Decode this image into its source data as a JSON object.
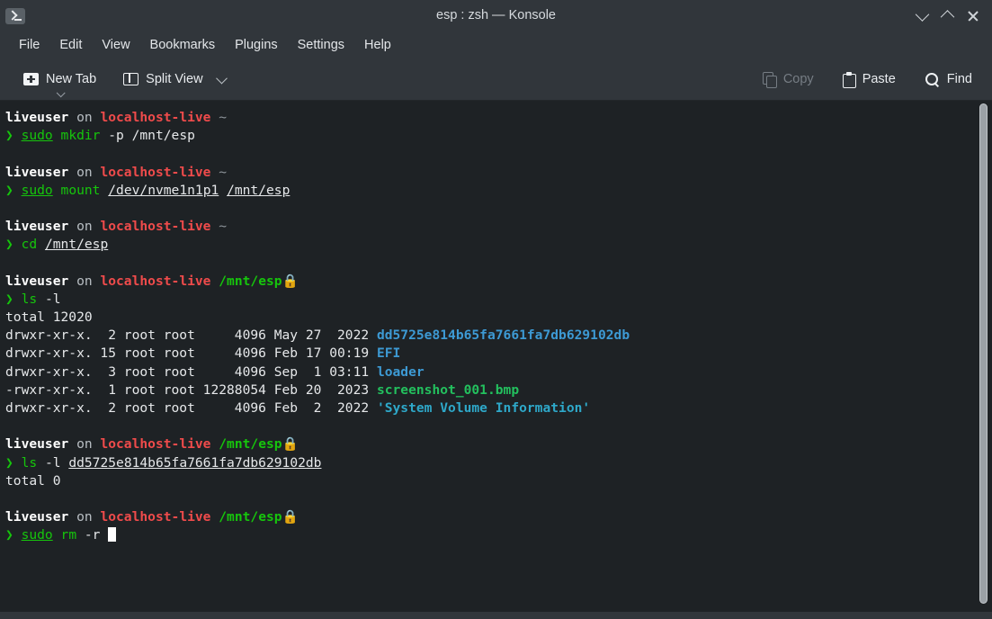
{
  "window": {
    "title": "esp : zsh — Konsole",
    "app_icon": "terminal-icon",
    "controls": {
      "minimize": "chevron-down-icon",
      "maximize": "chevron-up-icon",
      "close": "close-icon"
    }
  },
  "menubar": {
    "items": [
      {
        "label": "File"
      },
      {
        "label": "Edit"
      },
      {
        "label": "View"
      },
      {
        "label": "Bookmarks"
      },
      {
        "label": "Plugins"
      },
      {
        "label": "Settings"
      },
      {
        "label": "Help"
      }
    ]
  },
  "toolbar": {
    "new_tab": {
      "label": "New Tab",
      "icon": "new-tab-icon"
    },
    "split_view": {
      "label": "Split View",
      "icon": "split-view-icon"
    },
    "copy": {
      "label": "Copy",
      "icon": "copy-icon",
      "disabled": true
    },
    "paste": {
      "label": "Paste",
      "icon": "paste-icon",
      "disabled": false
    },
    "find": {
      "label": "Find",
      "icon": "search-icon",
      "disabled": false
    }
  },
  "terminal": {
    "colors": {
      "background": "#1e2225",
      "foreground": "#e6e8ea",
      "green": "#16c60c",
      "red": "#ef4b4b",
      "blue": "#3d9ad4",
      "cyan": "#2ea8c9",
      "exec_green": "#23c05e"
    },
    "prompt": {
      "user": "liveuser",
      "on": "on",
      "host": "localhost-live",
      "arrow": "❯",
      "lock": "🔒"
    },
    "blocks": [
      {
        "prompt_path": "~",
        "locked": false,
        "command_segments": [
          {
            "text": "sudo",
            "style": "sudo"
          },
          {
            "text": " ",
            "style": "plain"
          },
          {
            "text": "mkdir",
            "style": "cmd"
          },
          {
            "text": " -p /mnt/esp",
            "style": "plain"
          }
        ],
        "output": []
      },
      {
        "prompt_path": "~",
        "locked": false,
        "command_segments": [
          {
            "text": "sudo",
            "style": "sudo"
          },
          {
            "text": " ",
            "style": "plain"
          },
          {
            "text": "mount",
            "style": "cmd"
          },
          {
            "text": " ",
            "style": "plain"
          },
          {
            "text": "/dev/nvme1n1p1",
            "style": "uline"
          },
          {
            "text": " ",
            "style": "plain"
          },
          {
            "text": "/mnt/esp",
            "style": "uline"
          }
        ],
        "output": []
      },
      {
        "prompt_path": "~",
        "locked": false,
        "command_segments": [
          {
            "text": "cd",
            "style": "cmd"
          },
          {
            "text": " ",
            "style": "plain"
          },
          {
            "text": "/mnt/esp",
            "style": "uline"
          }
        ],
        "output": []
      },
      {
        "prompt_path": "/mnt/esp",
        "locked": true,
        "command_segments": [
          {
            "text": "ls",
            "style": "cmd"
          },
          {
            "text": " -l",
            "style": "plain"
          }
        ],
        "output": [
          [
            {
              "text": "total 12020",
              "style": "plain"
            }
          ],
          [
            {
              "text": "drwxr-xr-x.  2 root root     4096 May 27  2022 ",
              "style": "plain"
            },
            {
              "text": "dd5725e814b65fa7661fa7db629102db",
              "style": "dir"
            }
          ],
          [
            {
              "text": "drwxr-xr-x. 15 root root     4096 Feb 17 00:19 ",
              "style": "plain"
            },
            {
              "text": "EFI",
              "style": "dir"
            }
          ],
          [
            {
              "text": "drwxr-xr-x.  3 root root     4096 Sep  1 03:11 ",
              "style": "plain"
            },
            {
              "text": "loader",
              "style": "dir"
            }
          ],
          [
            {
              "text": "-rwxr-xr-x.  1 root root 12288054 Feb 20  2023 ",
              "style": "plain"
            },
            {
              "text": "screenshot_001.bmp",
              "style": "exec"
            }
          ],
          [
            {
              "text": "drwxr-xr-x.  2 root root     4096 Feb  2  2022 ",
              "style": "plain"
            },
            {
              "text": "'System Volume Information'",
              "style": "quote"
            }
          ]
        ]
      },
      {
        "prompt_path": "/mnt/esp",
        "locked": true,
        "command_segments": [
          {
            "text": "ls",
            "style": "cmd"
          },
          {
            "text": " -l ",
            "style": "plain"
          },
          {
            "text": "dd5725e814b65fa7661fa7db629102db",
            "style": "uline"
          }
        ],
        "output": [
          [
            {
              "text": "total 0",
              "style": "plain"
            }
          ]
        ]
      },
      {
        "prompt_path": "/mnt/esp",
        "locked": true,
        "command_segments": [
          {
            "text": "sudo",
            "style": "sudo"
          },
          {
            "text": " ",
            "style": "plain"
          },
          {
            "text": "rm",
            "style": "cmd"
          },
          {
            "text": " -r ",
            "style": "plain"
          }
        ],
        "cursor": true,
        "output": []
      }
    ]
  }
}
